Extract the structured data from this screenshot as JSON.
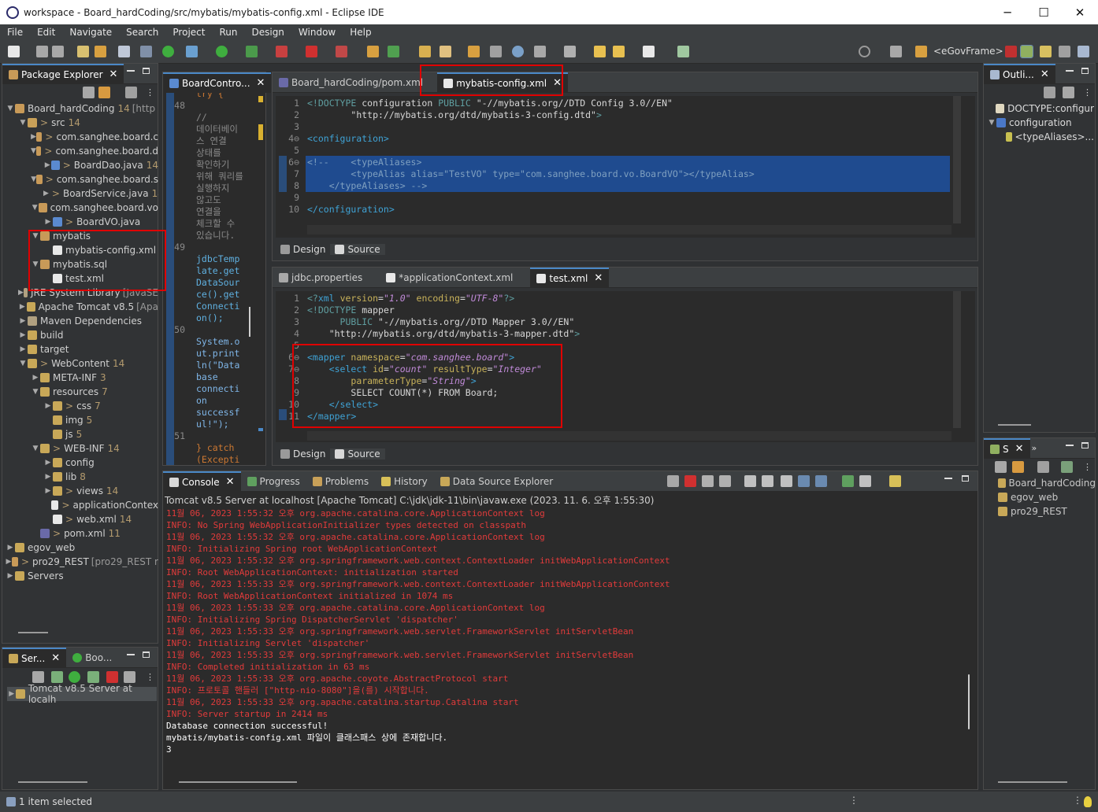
{
  "window": {
    "title": "workspace - Board_hardCoding/src/mybatis/mybatis-config.xml - Eclipse IDE",
    "minimize": "─",
    "maximize": "☐",
    "close": "✕"
  },
  "menu": [
    "File",
    "Edit",
    "Navigate",
    "Search",
    "Project",
    "Run",
    "Design",
    "Window",
    "Help"
  ],
  "toolbar": {
    "perspective_label": "<eGovFrame>"
  },
  "package_explorer": {
    "title": "Package Explorer",
    "items": [
      {
        "label": "Board_hardCoding",
        "count": "14",
        "dec": "[http"
      },
      {
        "label": "src",
        "count": "14",
        "prefix": ">"
      },
      {
        "label": "com.sanghee.board.c",
        "prefix": ">"
      },
      {
        "label": "com.sanghee.board.d",
        "prefix": ">"
      },
      {
        "label": "BoardDao.java",
        "count": "14",
        "prefix": ">"
      },
      {
        "label": "com.sanghee.board.s",
        "prefix": ">"
      },
      {
        "label": "BoardService.java",
        "count": "14",
        "prefix": ">"
      },
      {
        "label": "com.sanghee.board.vo"
      },
      {
        "label": "BoardVO.java",
        "prefix": ">"
      },
      {
        "label": "mybatis"
      },
      {
        "label": "mybatis-config.xml"
      },
      {
        "label": "mybatis.sql"
      },
      {
        "label": "test.xml"
      },
      {
        "label": "JRE System Library",
        "dec": "[JavaSE"
      },
      {
        "label": "Apache Tomcat v8.5",
        "dec": "[Apa"
      },
      {
        "label": "Maven Dependencies"
      },
      {
        "label": "build"
      },
      {
        "label": "target"
      },
      {
        "label": "WebContent",
        "count": "14",
        "prefix": ">"
      },
      {
        "label": "META-INF",
        "count": "3"
      },
      {
        "label": "resources",
        "count": "7"
      },
      {
        "label": "css",
        "count": "7",
        "prefix": ">"
      },
      {
        "label": "img",
        "count": "5"
      },
      {
        "label": "js",
        "count": "5"
      },
      {
        "label": "WEB-INF",
        "count": "14",
        "prefix": ">"
      },
      {
        "label": "config"
      },
      {
        "label": "lib",
        "count": "8"
      },
      {
        "label": "views",
        "count": "14",
        "prefix": ">"
      },
      {
        "label": "applicationContex",
        "prefix": ">"
      },
      {
        "label": "web.xml",
        "count": "14",
        "prefix": ">"
      },
      {
        "label": "pom.xml",
        "count": "11",
        "prefix": ">"
      },
      {
        "label": "egov_web"
      },
      {
        "label": "pro29_REST",
        "dec": "[pro29_REST r",
        "prefix": ">"
      },
      {
        "label": "Servers"
      }
    ]
  },
  "servers_panel": {
    "tabs": [
      "Ser...",
      "Boo..."
    ],
    "item": "Tomcat v8.5 Server at localh"
  },
  "board_controller_editor": {
    "tab": "BoardContro...",
    "lines": [
      {
        "n": "",
        "t": "try {"
      },
      {
        "n": "48",
        "t": ""
      },
      {
        "n": "",
        "t": "//"
      },
      {
        "n": "",
        "t": "데이터베이"
      },
      {
        "n": "",
        "t": "스 연결"
      },
      {
        "n": "",
        "t": "상태를"
      },
      {
        "n": "",
        "t": "확인하기"
      },
      {
        "n": "",
        "t": "위해 쿼리를"
      },
      {
        "n": "",
        "t": "실행하지"
      },
      {
        "n": "",
        "t": "않고도"
      },
      {
        "n": "",
        "t": "연결을"
      },
      {
        "n": "",
        "t": "체크할 수"
      },
      {
        "n": "",
        "t": "있습니다."
      },
      {
        "n": "49",
        "t": ""
      },
      {
        "n": "",
        "t": "jdbcTemp"
      },
      {
        "n": "",
        "t": "late.get"
      },
      {
        "n": "",
        "t": "DataSour"
      },
      {
        "n": "",
        "t": "ce().get"
      },
      {
        "n": "",
        "t": "Connecti"
      },
      {
        "n": "",
        "t": "on();"
      },
      {
        "n": "50",
        "t": ""
      },
      {
        "n": "",
        "t": "System.o"
      },
      {
        "n": "",
        "t": "ut.print"
      },
      {
        "n": "",
        "t": "ln(\"Data"
      },
      {
        "n": "",
        "t": "base"
      },
      {
        "n": "",
        "t": "connecti"
      },
      {
        "n": "",
        "t": "on"
      },
      {
        "n": "",
        "t": "successf"
      },
      {
        "n": "",
        "t": "ul!\");"
      },
      {
        "n": "51",
        "t": ""
      },
      {
        "n": "",
        "t": "} catch"
      },
      {
        "n": "",
        "t": "(Excepti"
      }
    ]
  },
  "top_editor": {
    "tabs": [
      "Board_hardCoding/pom.xml",
      "mybatis-config.xml"
    ],
    "bottom_tabs": [
      "Design",
      "Source"
    ]
  },
  "bottom_editor": {
    "tabs": [
      "jdbc.properties",
      "*applicationContext.xml",
      "test.xml"
    ],
    "bottom_tabs": [
      "Design",
      "Source"
    ]
  },
  "console": {
    "tabs": [
      "Console",
      "Progress",
      "Problems",
      "History",
      "Data Source Explorer"
    ],
    "header": "Tomcat v8.5 Server at localhost [Apache Tomcat] C:\\jdk\\jdk-11\\bin\\javaw.exe  (2023. 11. 6. 오후 1:55:30)",
    "lines": [
      {
        "c": "red",
        "t": "11월 06, 2023 1:55:32 오후 org.apache.catalina.core.ApplicationContext log"
      },
      {
        "c": "red",
        "t": "INFO: No Spring WebApplicationInitializer types detected on classpath"
      },
      {
        "c": "red",
        "t": "11월 06, 2023 1:55:32 오후 org.apache.catalina.core.ApplicationContext log"
      },
      {
        "c": "red",
        "t": "INFO: Initializing Spring root WebApplicationContext"
      },
      {
        "c": "red",
        "t": "11월 06, 2023 1:55:32 오후 org.springframework.web.context.ContextLoader initWebApplicationContext"
      },
      {
        "c": "red",
        "t": "INFO: Root WebApplicationContext: initialization started"
      },
      {
        "c": "red",
        "t": "11월 06, 2023 1:55:33 오후 org.springframework.web.context.ContextLoader initWebApplicationContext"
      },
      {
        "c": "red",
        "t": "INFO: Root WebApplicationContext initialized in 1074 ms"
      },
      {
        "c": "red",
        "t": "11월 06, 2023 1:55:33 오후 org.apache.catalina.core.ApplicationContext log"
      },
      {
        "c": "red",
        "t": "INFO: Initializing Spring DispatcherServlet 'dispatcher'"
      },
      {
        "c": "red",
        "t": "11월 06, 2023 1:55:33 오후 org.springframework.web.servlet.FrameworkServlet initServletBean"
      },
      {
        "c": "red",
        "t": "INFO: Initializing Servlet 'dispatcher'"
      },
      {
        "c": "red",
        "t": "11월 06, 2023 1:55:33 오후 org.springframework.web.servlet.FrameworkServlet initServletBean"
      },
      {
        "c": "red",
        "t": "INFO: Completed initialization in 63 ms"
      },
      {
        "c": "red",
        "t": "11월 06, 2023 1:55:33 오후 org.apache.coyote.AbstractProtocol start"
      },
      {
        "c": "red",
        "t": "INFO: 프로토콜 핸들러 [\"http-nio-8080\"]을(를) 시작합니다."
      },
      {
        "c": "red",
        "t": "11월 06, 2023 1:55:33 오후 org.apache.catalina.startup.Catalina start"
      },
      {
        "c": "red",
        "t": "INFO: Server startup in 2414 ms"
      },
      {
        "c": "white",
        "t": "Database connection successful!"
      },
      {
        "c": "white",
        "t": "mybatis/mybatis-config.xml 파일이 클래스패스 상에 존재합니다."
      },
      {
        "c": "white",
        "t": "3"
      }
    ]
  },
  "outline": {
    "title": "Outli...",
    "items": [
      "DOCTYPE:configur",
      "configuration",
      "<typeAliases>..."
    ]
  },
  "right_bottom": {
    "title": "S",
    "items": [
      "Board_hardCoding",
      "egov_web",
      "pro29_REST"
    ]
  },
  "status": {
    "text": "1 item selected"
  }
}
